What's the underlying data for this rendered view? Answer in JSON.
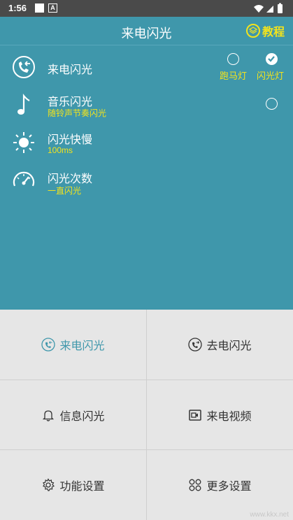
{
  "status_bar": {
    "time": "1:56",
    "notif_letter": "A"
  },
  "header": {
    "title": "来电闪光",
    "tutorial_label": "教程"
  },
  "options": {
    "marquee_label": "跑马灯",
    "flash_label": "闪光灯",
    "selected": "闪光灯"
  },
  "settings": [
    {
      "title": "来电闪光",
      "subtitle": "",
      "icon": "incoming-call-icon"
    },
    {
      "title": "音乐闪光",
      "subtitle": "随铃声节奏闪光",
      "icon": "music-note-icon"
    },
    {
      "title": "闪光快慢",
      "subtitle": "100ms",
      "icon": "sun-icon"
    },
    {
      "title": "闪光次数",
      "subtitle": "一直闪光",
      "icon": "speedometer-icon"
    }
  ],
  "grid": [
    {
      "label": "来电闪光",
      "icon": "incoming-call-icon",
      "active": true
    },
    {
      "label": "去电闪光",
      "icon": "outgoing-call-icon",
      "active": false
    },
    {
      "label": "信息闪光",
      "icon": "bell-icon",
      "active": false
    },
    {
      "label": "来电视频",
      "icon": "video-icon",
      "active": false
    },
    {
      "label": "功能设置",
      "icon": "gear-icon",
      "active": false
    },
    {
      "label": "更多设置",
      "icon": "grid-icon",
      "active": false
    }
  ],
  "colors": {
    "primary": "#3f97ab",
    "accent": "#f3e31c"
  },
  "watermark": "www.kkx.net"
}
